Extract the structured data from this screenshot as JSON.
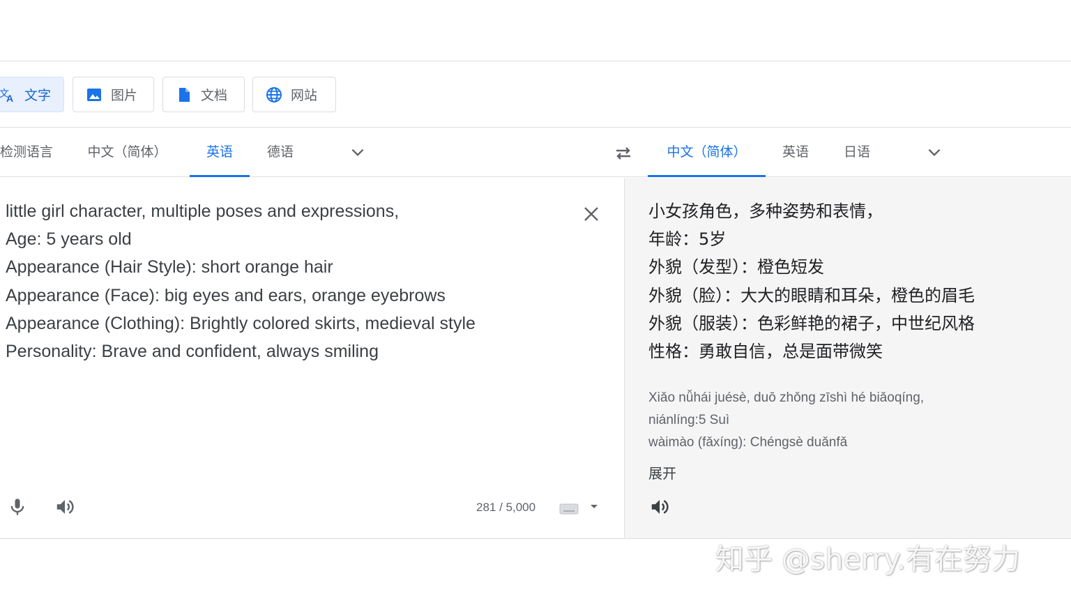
{
  "modes": {
    "text": "文字",
    "image": "图片",
    "document": "文档",
    "website": "网站"
  },
  "source_langs": {
    "detect": "检测语言",
    "chinese_simplified": "中文（简体）",
    "english": "英语",
    "german": "德语",
    "selected": "英语"
  },
  "target_langs": {
    "chinese_simplified": "中文（简体）",
    "english": "英语",
    "japanese": "日语",
    "selected": "中文（简体）"
  },
  "source_text": [
    "little girl character, multiple poses and expressions,",
    "Age: 5 years old",
    "Appearance (Hair Style): short orange hair",
    "Appearance (Face): big eyes and ears, orange eyebrows",
    "Appearance (Clothing): Brightly colored skirts, medieval style",
    "Personality: Brave and confident, always smiling"
  ],
  "translated_text": [
    "小女孩角色，多种姿势和表情，",
    "年龄：5岁",
    "外貌（发型）：橙色短发",
    "外貌（脸）：大大的眼睛和耳朵，橙色的眉毛",
    "外貌（服装）：色彩鲜艳的裙子，中世纪风格",
    "性格：勇敢自信，总是面带微笑"
  ],
  "transliteration": [
    "Xiǎo nǚhái juésè, duō zhǒng zīshì hé biǎoqíng,",
    "niánlíng:5 Suì",
    "wàimào (fǎxíng): Chéngsè duǎnfǎ"
  ],
  "expand_label": "展开",
  "char_counter": "281 / 5,000",
  "watermark": "知乎 @sherry.有在努力",
  "colors": {
    "accent": "#1a73e8",
    "active_mode_bg": "#e8f0fe",
    "target_panel_bg": "#f5f5f5"
  },
  "icons": {
    "text_mode": "translate-icon",
    "image_mode": "image-icon",
    "document_mode": "document-icon",
    "website_mode": "globe-icon",
    "swap": "swap-icon",
    "clear": "close-icon",
    "mic": "mic-icon",
    "speaker": "speaker-icon",
    "keyboard": "keyboard-icon"
  }
}
